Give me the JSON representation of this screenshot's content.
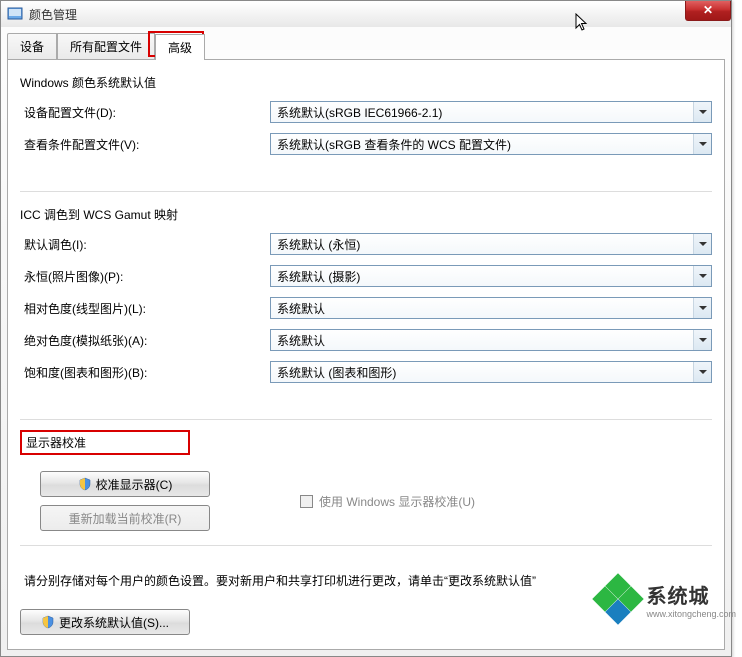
{
  "window": {
    "title": "颜色管理"
  },
  "tabs": {
    "devices": "设备",
    "profiles": "所有配置文件",
    "advanced": "高级"
  },
  "group1": {
    "title": "Windows 颜色系统默认值",
    "device_profile_label": "设备配置文件(D):",
    "device_profile_value": "系统默认(sRGB IEC61966-2.1)",
    "viewing_label": "查看条件配置文件(V):",
    "viewing_value": "系统默认(sRGB 查看条件的 WCS 配置文件)"
  },
  "group2": {
    "title": "ICC 调色到 WCS Gamut 映射",
    "default_intent_label": "默认调色(I):",
    "default_intent_value": "系统默认 (永恒)",
    "perm_label": "永恒(照片图像)(P):",
    "perm_value": "系统默认 (摄影)",
    "rel_label": "相对色度(线型图片)(L):",
    "rel_value": "系统默认",
    "abs_label": "绝对色度(模拟纸张)(A):",
    "abs_value": "系统默认",
    "sat_label": "饱和度(图表和图形)(B):",
    "sat_value": "系统默认 (图表和图形)"
  },
  "calib": {
    "title": "显示器校准",
    "calibrate_btn": "校准显示器(C)",
    "reload_btn": "重新加载当前校准(R)",
    "use_windows_label": "使用 Windows 显示器校准(U)"
  },
  "instruction": "请分别存储对每个用户的颜色设置。要对新用户和共享打印机进行更改，请单击“更改系统默认值”",
  "change_defaults_btn": "更改系统默认值(S)...",
  "watermark": {
    "brand": "系统城",
    "url": "www.xitongcheng.com"
  }
}
